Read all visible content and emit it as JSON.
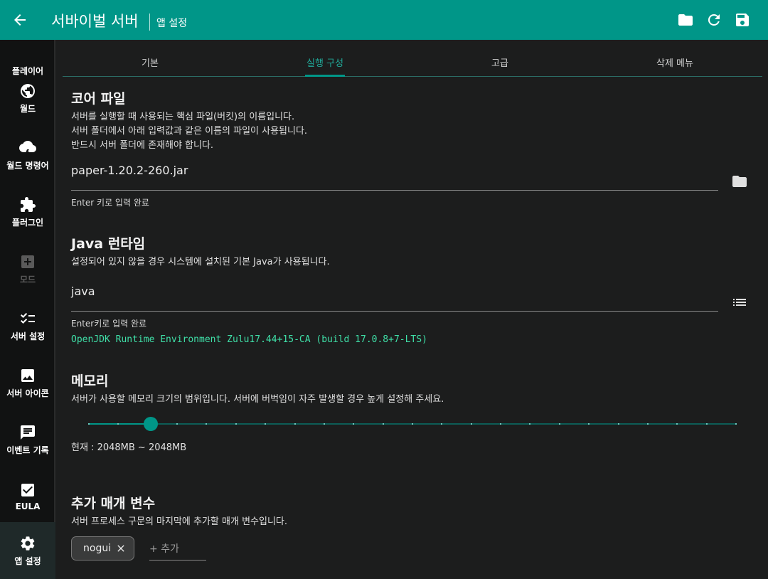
{
  "appbar": {
    "title": "서바이벌 서버",
    "subtitle": "앱 설정",
    "actions": [
      "folder-icon",
      "refresh-icon",
      "save-icon"
    ]
  },
  "sidebar": {
    "items": [
      {
        "label": "플레이어",
        "icon": "person-icon"
      },
      {
        "label": "월드",
        "icon": "globe-icon"
      },
      {
        "label": "월드 명령어",
        "icon": "storm-icon"
      },
      {
        "label": "플러그인",
        "icon": "puzzle-icon"
      },
      {
        "label": "모드",
        "icon": "add-box-icon",
        "disabled": true
      },
      {
        "label": "서버 설정",
        "icon": "checklist-icon"
      },
      {
        "label": "서버 아이콘",
        "icon": "image-icon"
      },
      {
        "label": "이벤트 기록",
        "icon": "chat-icon"
      },
      {
        "label": "EULA",
        "icon": "check-box-icon"
      },
      {
        "label": "앱 설정",
        "icon": "gear-icon",
        "active": true
      }
    ]
  },
  "tabs": [
    {
      "label": "기본"
    },
    {
      "label": "실행 구성",
      "active": true
    },
    {
      "label": "고급"
    },
    {
      "label": "삭제 메뉴"
    }
  ],
  "core_file": {
    "title": "코어 파일",
    "desc1": "서버를 실행할 때 사용되는 핵심 파일(버킷)의 이름입니다.",
    "desc2": "서버 폴더에서 아래 입력값과 같은 이름의 파일이 사용됩니다.",
    "desc3": "반드시 서버 폴더에 존재해야 합니다.",
    "value": "paper-1.20.2-260.jar",
    "helper": "Enter 키로 입력 완료"
  },
  "java_runtime": {
    "title": "Java 런타임",
    "desc": "설정되어 있지 않을 경우 시스템에 설치된 기본 Java가 사용됩니다.",
    "value": "java",
    "helper": "Enter키로 입력 완료",
    "version": "OpenJDK Runtime Environment Zulu17.44+15-CA (build 17.0.8+7-LTS)"
  },
  "memory": {
    "title": "메모리",
    "desc": "서버가 사용할 메모리 크기의 범위입니다. 서버에 버벅임이 자주 발생할 경우 높게 설정해 주세요.",
    "current": "현재 : 2048MB ~ 2048MB",
    "slider_fraction": 0.096,
    "tick_count": 23
  },
  "extra_params": {
    "title": "추가 매개 변수",
    "desc": "서버 프로세스 구문의 마지막에 추가할 매개 변수입니다.",
    "chips": [
      "nogui"
    ],
    "add_placeholder": "+ 추가"
  },
  "colors": {
    "accent": "#009688",
    "mono_text": "#3fe0a8"
  }
}
